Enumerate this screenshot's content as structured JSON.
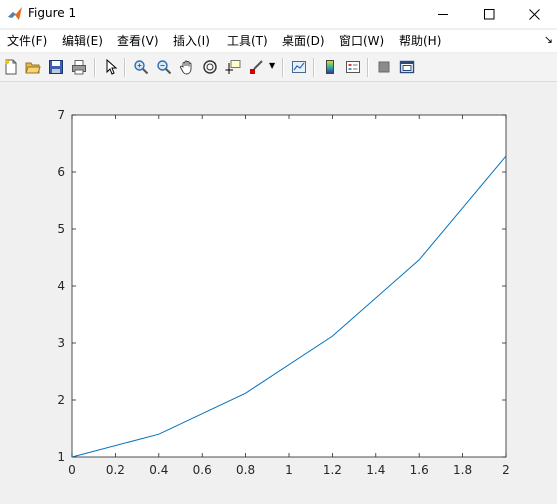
{
  "window": {
    "title": "Figure 1",
    "controls": [
      "minimize",
      "maximize",
      "close"
    ]
  },
  "menu": {
    "items": [
      {
        "label": "文件(F)"
      },
      {
        "label": "编辑(E)"
      },
      {
        "label": "查看(V)"
      },
      {
        "label": "插入(I)"
      },
      {
        "label": "工具(T)"
      },
      {
        "label": "桌面(D)"
      },
      {
        "label": "窗口(W)"
      },
      {
        "label": "帮助(H)"
      }
    ]
  },
  "toolbar": {
    "buttons": [
      "new-figure-icon",
      "open-file-icon",
      "save-icon",
      "print-icon",
      "edit-plot-cursor-icon",
      "zoom-in-icon",
      "zoom-out-icon",
      "pan-hand-icon",
      "rotate-3d-icon",
      "data-cursor-icon",
      "brush-icon",
      "link-plot-icon",
      "insert-colorbar-icon",
      "insert-legend-icon",
      "hide-plot-tools-icon",
      "show-plot-tools-icon"
    ]
  },
  "chart_data": {
    "type": "line",
    "x": [
      0,
      0.4,
      0.8,
      1.2,
      1.6,
      2.0
    ],
    "series": [
      {
        "color": "#0072bd",
        "values": [
          1.0,
          1.4,
          2.12,
          3.12,
          4.46,
          6.28
        ]
      }
    ],
    "xlim": [
      0,
      2
    ],
    "ylim": [
      1,
      7
    ],
    "xticks": [
      "0",
      "0.2",
      "0.4",
      "0.6",
      "0.8",
      "1",
      "1.2",
      "1.4",
      "1.6",
      "1.8",
      "2"
    ],
    "yticks": [
      "1",
      "2",
      "3",
      "4",
      "5",
      "6",
      "7"
    ],
    "title": "",
    "xlabel": "",
    "ylabel": "",
    "grid": false
  }
}
